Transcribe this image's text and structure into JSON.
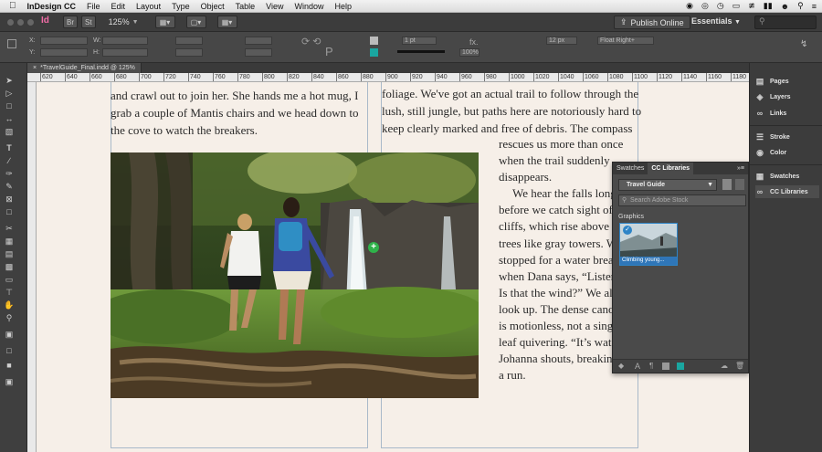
{
  "menubar": {
    "app": "InDesign CC",
    "items": [
      "File",
      "Edit",
      "Layout",
      "Type",
      "Object",
      "Table",
      "View",
      "Window",
      "Help"
    ]
  },
  "appbar": {
    "zoom": "125%",
    "publish_label": "Publish Online",
    "workspace": "Essentials",
    "br_label": "Br",
    "st_label": "St"
  },
  "control": {
    "stroke_weight": "1 pt",
    "opacity": "100%",
    "spacing": "12 px",
    "object_style": "Float Right+"
  },
  "document": {
    "tab_title": "*TravelGuide_Final.indd @ 125%"
  },
  "ruler": {
    "ticks": [
      "620",
      "640",
      "660",
      "680",
      "700",
      "720",
      "740",
      "760",
      "780",
      "800",
      "820",
      "840",
      "860",
      "880",
      "900",
      "920",
      "940",
      "960",
      "980",
      "1000",
      "1020",
      "1040",
      "1060",
      "1080",
      "1100",
      "1120",
      "1140",
      "1160",
      "1180"
    ]
  },
  "content": {
    "left_col": [
      "and crawl out to join her. She hands me a hot mug, I",
      "grab a couple of Mantis chairs and we head down to",
      "the cove to watch the breakers."
    ],
    "right_top": [
      "foliage. We've got an actual trail to follow through the",
      "lush, still jungle, but paths here are notoriously hard to",
      "keep clearly marked and free of debris. The compass"
    ],
    "right_wrap": [
      "rescues us more than once",
      "when the trail suddenly",
      "disappears.",
      "We hear the falls long",
      "before we catch sight of",
      "cliffs, which rise above the",
      "trees like gray towers. W",
      "stopped for a water brea",
      "when Dana says, “Listen",
      "Is that the wind?” We all",
      "look up. The dense canop",
      "is motionless, not a singl",
      "leaf quivering. “It’s water",
      "Johanna shouts, breaking",
      "a run."
    ]
  },
  "dock": {
    "items": [
      "Pages",
      "Layers",
      "Links",
      "Stroke",
      "Color",
      "Swatches",
      "CC Libraries"
    ],
    "icons": [
      "pages-icon",
      "layers-icon",
      "links-icon",
      "stroke-icon",
      "color-icon",
      "swatches-icon",
      "cc-libraries-icon"
    ]
  },
  "cc_panel": {
    "tabs": [
      "Swatches",
      "CC Libraries"
    ],
    "library": "Travel Guide",
    "stock_placeholder": "Search Adobe Stock",
    "section": "Graphics",
    "asset_name": "Climbing young..."
  },
  "colors": {
    "accent": "#2d84c7",
    "indesign_pink": "#f26ca7",
    "teal_swatch": "#1aa6a0"
  }
}
